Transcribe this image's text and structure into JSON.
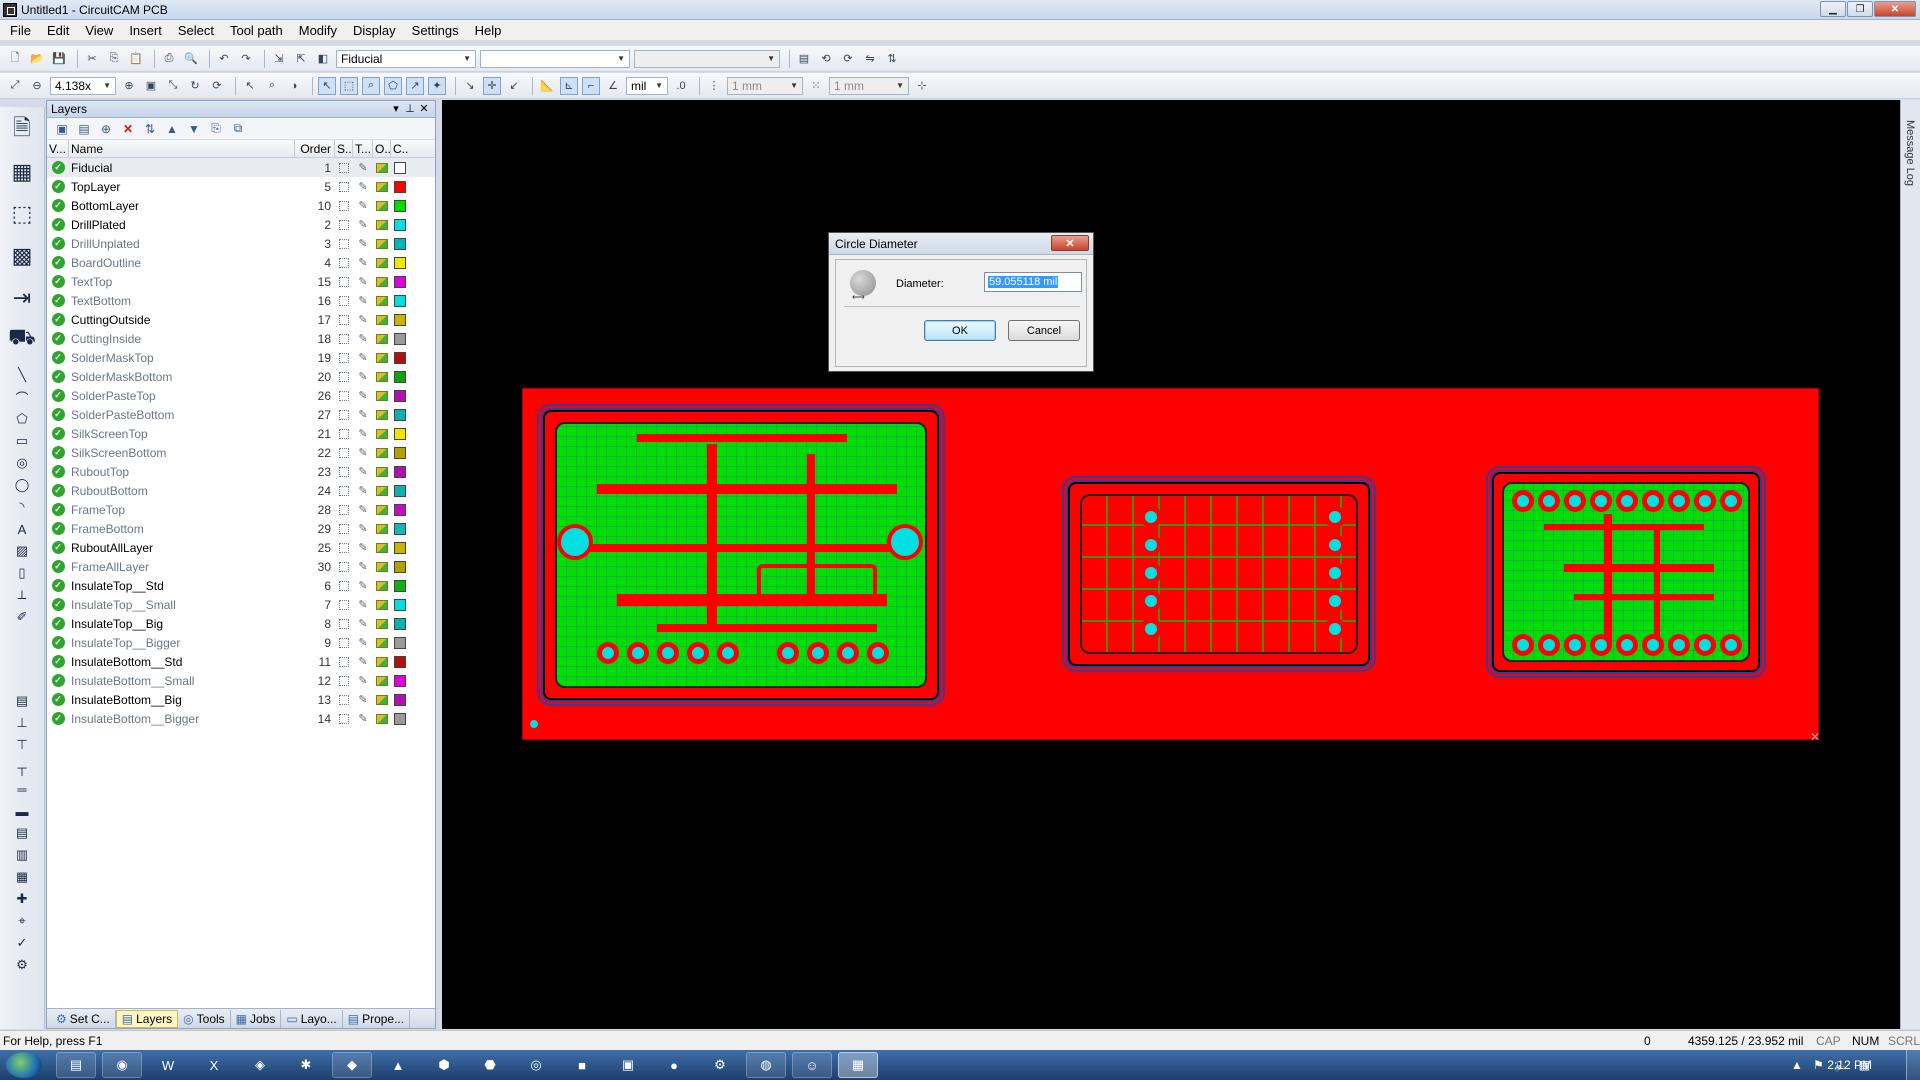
{
  "window": {
    "title": "Untitled1 - CircuitCAM PCB"
  },
  "menu": [
    "File",
    "Edit",
    "View",
    "Insert",
    "Select",
    "Tool path",
    "Modify",
    "Display",
    "Settings",
    "Help"
  ],
  "toolbar": {
    "layer_combo": "Fiducial",
    "zoom_combo": "4.138x",
    "unit_combo": "mil",
    "grid_spacing": "1 mm",
    "snap_spacing": "1 mm"
  },
  "layers_panel": {
    "title": "Layers",
    "columns": [
      "V...",
      "Name",
      "Order",
      "S...",
      "T...",
      "O...",
      "C..."
    ],
    "rows": [
      {
        "name": "Fiducial",
        "order": "1",
        "color": "#ffffff",
        "bold": true
      },
      {
        "name": "TopLayer",
        "order": "5",
        "color": "#ff0000",
        "bold": true
      },
      {
        "name": "BottomLayer",
        "order": "10",
        "color": "#00e000",
        "bold": true
      },
      {
        "name": "DrillPlated",
        "order": "2",
        "color": "#00e0e0",
        "bold": true
      },
      {
        "name": "DrillUnplated",
        "order": "3",
        "color": "#00b8b8",
        "bold": false
      },
      {
        "name": "BoardOutline",
        "order": "4",
        "color": "#f2e600",
        "bold": false
      },
      {
        "name": "TextTop",
        "order": "15",
        "color": "#e000e0",
        "bold": false
      },
      {
        "name": "TextBottom",
        "order": "16",
        "color": "#00e0e0",
        "bold": false
      },
      {
        "name": "CuttingOutside",
        "order": "17",
        "color": "#c8b400",
        "bold": true
      },
      {
        "name": "CuttingInside",
        "order": "18",
        "color": "#9a9a9a",
        "bold": false
      },
      {
        "name": "SolderMaskTop",
        "order": "19",
        "color": "#b01010",
        "bold": false
      },
      {
        "name": "SolderMaskBottom",
        "order": "20",
        "color": "#10a010",
        "bold": false
      },
      {
        "name": "SolderPasteTop",
        "order": "26",
        "color": "#b010b0",
        "bold": false
      },
      {
        "name": "SolderPasteBottom",
        "order": "27",
        "color": "#10b0b0",
        "bold": false
      },
      {
        "name": "SilkScreenTop",
        "order": "21",
        "color": "#f2e600",
        "bold": false
      },
      {
        "name": "SilkScreenBottom",
        "order": "22",
        "color": "#b0a000",
        "bold": false
      },
      {
        "name": "RuboutTop",
        "order": "23",
        "color": "#b010b0",
        "bold": false
      },
      {
        "name": "RuboutBottom",
        "order": "24",
        "color": "#10b0b0",
        "bold": false
      },
      {
        "name": "FrameTop",
        "order": "28",
        "color": "#c010c0",
        "bold": false
      },
      {
        "name": "FrameBottom",
        "order": "29",
        "color": "#10b8b8",
        "bold": false
      },
      {
        "name": "RuboutAllLayer",
        "order": "25",
        "color": "#c8b400",
        "bold": true
      },
      {
        "name": "FrameAllLayer",
        "order": "30",
        "color": "#b0a000",
        "bold": false
      },
      {
        "name": "InsulateTop__Std",
        "order": "6",
        "color": "#10b010",
        "bold": true
      },
      {
        "name": "InsulateTop__Small",
        "order": "7",
        "color": "#00e0e0",
        "bold": false
      },
      {
        "name": "InsulateTop__Big",
        "order": "8",
        "color": "#10b0b0",
        "bold": true
      },
      {
        "name": "InsulateTop__Bigger",
        "order": "9",
        "color": "#9a9a9a",
        "bold": false
      },
      {
        "name": "InsulateBottom__Std",
        "order": "11",
        "color": "#b01010",
        "bold": true
      },
      {
        "name": "InsulateBottom__Small",
        "order": "12",
        "color": "#e000e0",
        "bold": false
      },
      {
        "name": "InsulateBottom__Big",
        "order": "13",
        "color": "#b010b0",
        "bold": true
      },
      {
        "name": "InsulateBottom__Bigger",
        "order": "14",
        "color": "#9a9a9a",
        "bold": false
      }
    ],
    "tabs": [
      "Set C...",
      "Layers",
      "Tools",
      "Jobs",
      "Layo...",
      "Prope..."
    ]
  },
  "message_log": {
    "label": "Message Log"
  },
  "dialog": {
    "title": "Circle Diameter",
    "close_label": "✕",
    "diameter_label": "Diameter:",
    "diameter_value": "59.055118 mil",
    "ok_label": "OK",
    "cancel_label": "Cancel"
  },
  "status": {
    "help_text": "For Help, press F1",
    "count": "0",
    "coords": "4359.125 / 23.952 mil",
    "cap": "CAP",
    "num": "NUM",
    "scrl": "SCRL"
  },
  "taskbar": {
    "clock": "2:12 PM"
  }
}
